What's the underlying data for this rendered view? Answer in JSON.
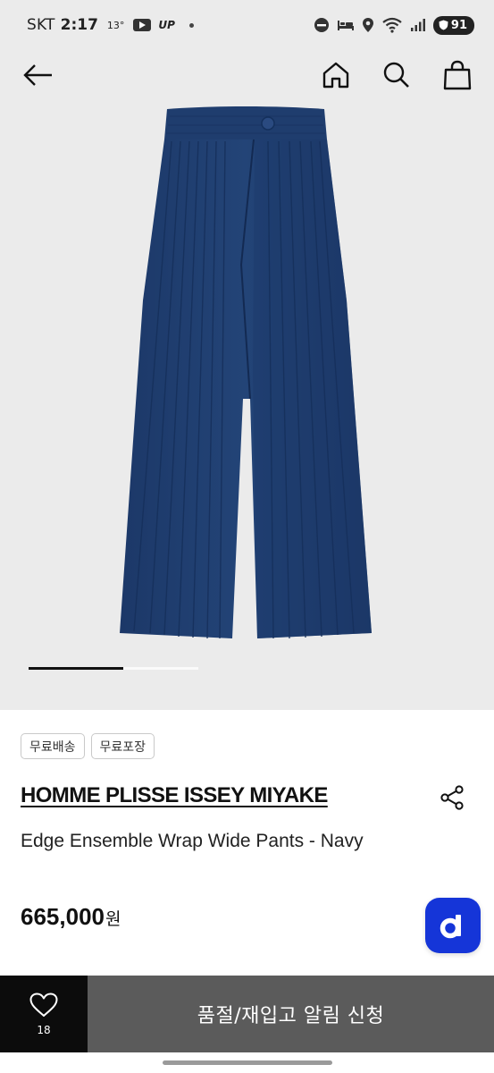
{
  "status_bar": {
    "carrier": "SKT",
    "time": "2:17",
    "temperature": "13°",
    "up_label": "UP",
    "battery": "91",
    "icons": [
      "youtube-icon",
      "dnd-icon",
      "bed-icon",
      "location-icon",
      "wifi-icon",
      "signal-icon",
      "battery-icon"
    ]
  },
  "header": {
    "icons": [
      "back-arrow-icon",
      "home-icon",
      "search-icon",
      "shopping-bag-icon"
    ]
  },
  "gallery": {
    "image_subject": "navy pleated wrap wide pants",
    "progress": 0.56
  },
  "product": {
    "tags": [
      "무료배송",
      "무료포장"
    ],
    "brand": "HOMME PLISSE ISSEY MIYAKE",
    "name": "Edge Ensemble Wrap Wide Pants - Navy",
    "price": "665,000",
    "currency": "원",
    "share_icon": "share-icon",
    "fab_letter": "d"
  },
  "bottom_bar": {
    "wishlist_count": "18",
    "action_label": "품절/재입고 알림 신청"
  },
  "colors": {
    "background_hero": "#ebebeb",
    "pants_navy": "#1f3f73",
    "fab_blue": "#1535d8",
    "wish_button": "#0c0c0c",
    "action_button": "#5b5b5b"
  }
}
